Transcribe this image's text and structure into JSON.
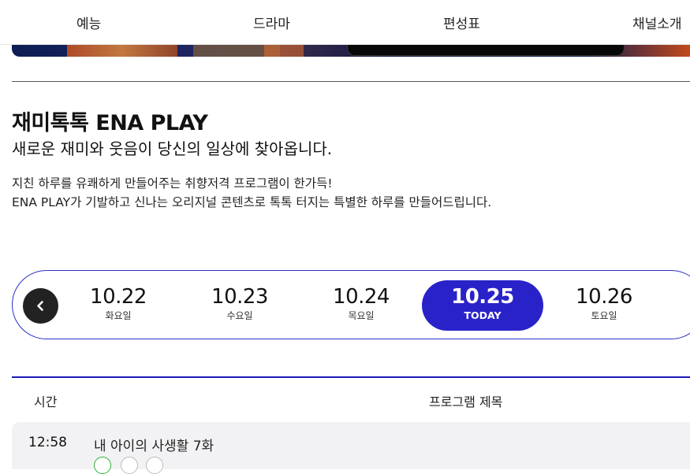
{
  "nav": {
    "items": [
      "예능",
      "드라마",
      "편성표",
      "채널소개"
    ]
  },
  "intro": {
    "title": "재미톡톡 ENA PLAY",
    "subtitle": "새로운 재미와 웃음이 당신의 일상에 찾아옵니다.",
    "desc_line1": "지친 하루를 유쾌하게 만들어주는 취향저격 프로그램이 한가득!",
    "desc_line2": "ENA PLAY가 기발하고 신나는 오리지널 콘텐츠로 톡톡 터지는 특별한 하루를 만들어드립니다."
  },
  "dates": [
    {
      "date": "10.22",
      "day": "화요일"
    },
    {
      "date": "10.23",
      "day": "수요일"
    },
    {
      "date": "10.24",
      "day": "목요일"
    },
    {
      "date": "10.25",
      "day": "TODAY",
      "active": true
    },
    {
      "date": "10.26",
      "day": "토요일"
    }
  ],
  "schedule": {
    "headers": {
      "time": "시간",
      "program": "프로그램 제목"
    },
    "rows": [
      {
        "time": "12:58",
        "program": "내 아이의 사생활 7화"
      }
    ]
  },
  "colors": {
    "accent": "#2a22c9",
    "border_accent": "#1a1ab8",
    "prev_button": "#222222",
    "row_bg": "#f2f2f4"
  }
}
